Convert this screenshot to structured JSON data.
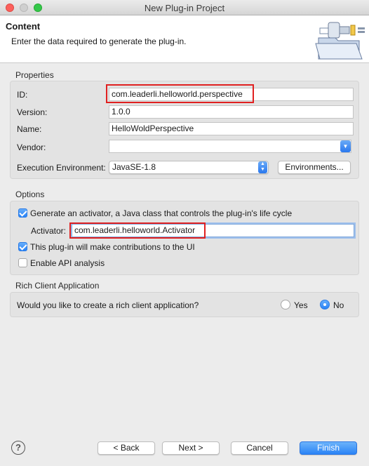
{
  "window": {
    "title": "New Plug-in Project"
  },
  "header": {
    "title": "Content",
    "description": "Enter the data required to generate the plug-in."
  },
  "properties": {
    "group_label": "Properties",
    "id_label": "ID:",
    "id_value": "com.leaderli.helloworld.perspective",
    "version_label": "Version:",
    "version_value": "1.0.0",
    "name_label": "Name:",
    "name_value": "HelloWoldPerspective",
    "vendor_label": "Vendor:",
    "vendor_value": "",
    "exec_env_label": "Execution Environment:",
    "exec_env_value": "JavaSE-1.8",
    "environments_button": "Environments..."
  },
  "options": {
    "group_label": "Options",
    "generate_activator_label": "Generate an activator, a Java class that controls the plug-in's life cycle",
    "generate_activator_checked": true,
    "activator_label": "Activator:",
    "activator_value": "com.leaderli.helloworld.Activator",
    "ui_contrib_label": "This plug-in will make contributions to the UI",
    "ui_contrib_checked": true,
    "api_analysis_label": "Enable API analysis",
    "api_analysis_checked": false
  },
  "rcp": {
    "group_label": "Rich Client Application",
    "question": "Would you like to create a rich client application?",
    "yes_label": "Yes",
    "no_label": "No",
    "selected": "No"
  },
  "footer": {
    "help_glyph": "?",
    "back_label": "< Back",
    "next_label": "Next >",
    "cancel_label": "Cancel",
    "finish_label": "Finish"
  },
  "icons": {
    "help": "help-icon",
    "banner": "plugin-folder-banner-icon",
    "dropdown": "chevron-updown-icon"
  },
  "colors": {
    "highlight": "#e02020",
    "accent": "#2a83f6",
    "close": "#fc605c",
    "maximize": "#34c84a"
  }
}
